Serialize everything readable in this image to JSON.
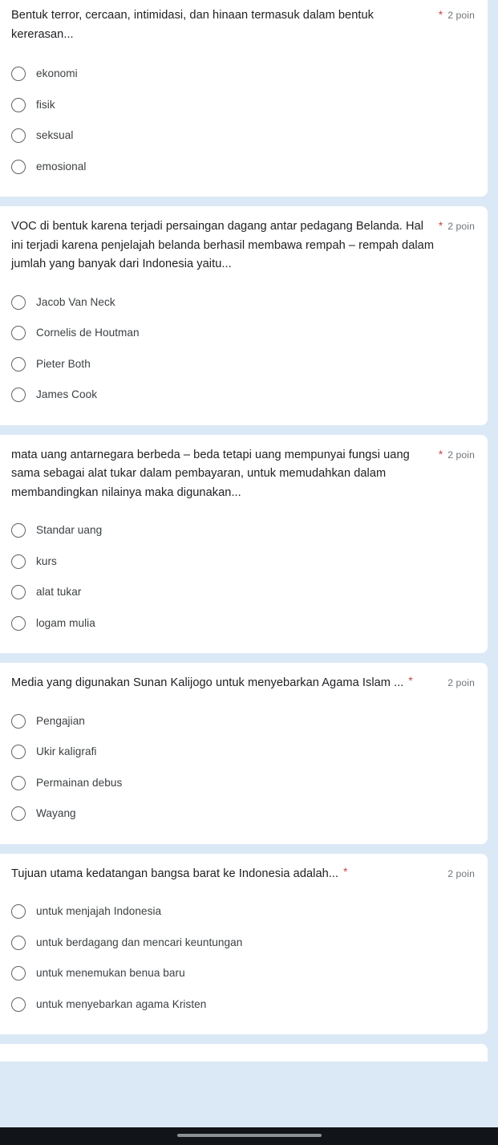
{
  "app": {
    "background_color": "#dbe9f6",
    "card_color": "#ffffff",
    "required_marker": "*",
    "required_color": "#c5473f",
    "points_color": "#70757a"
  },
  "questions": [
    {
      "id": "q1",
      "title": "Bentuk terror, cercaan, intimidasi, dan hinaan termasuk dalam bentuk kererasan...",
      "required": "*",
      "points": "2 poin",
      "layout": "wrap",
      "options": [
        "ekonomi",
        "fisik",
        "seksual",
        "emosional"
      ]
    },
    {
      "id": "q2",
      "title": "VOC di bentuk karena terjadi persaingan dagang antar pedagang Belanda. Hal ini terjadi karena penjelajah belanda berhasil membawa rempah – rempah dalam jumlah yang banyak dari Indonesia yaitu...",
      "required": "*",
      "points": "2 poin",
      "layout": "wrap",
      "options": [
        "Jacob Van Neck",
        "Cornelis de Houtman",
        "Pieter Both",
        "James Cook"
      ]
    },
    {
      "id": "q3",
      "title": "mata uang antarnegara berbeda – beda tetapi uang mempunyai fungsi uang sama sebagai alat tukar dalam pembayaran, untuk memudahkan dalam membandingkan nilainya maka digunakan...",
      "required": "*",
      "points": "2 poin",
      "layout": "wrap",
      "options": [
        "Standar uang",
        "kurs",
        "alat tukar",
        "logam mulia"
      ]
    },
    {
      "id": "q4",
      "title": "Media yang digunakan Sunan Kalijogo untuk menyebarkan Agama Islam ...",
      "required": "*",
      "points": "2 poin",
      "layout": "inline",
      "options": [
        "Pengajian",
        "Ukir kaligrafi",
        "Permainan debus",
        "Wayang"
      ]
    },
    {
      "id": "q5",
      "title": "Tujuan utama kedatangan bangsa barat ke Indonesia adalah...",
      "required": "*",
      "points": "2 poin",
      "layout": "inline",
      "options": [
        "untuk menjajah Indonesia",
        "untuk berdagang dan mencari keuntungan",
        "untuk menemukan benua baru",
        "untuk menyebarkan agama Kristen"
      ]
    }
  ],
  "nav_bar": {
    "background_color": "#111418",
    "pill_color": "#8b9095"
  }
}
